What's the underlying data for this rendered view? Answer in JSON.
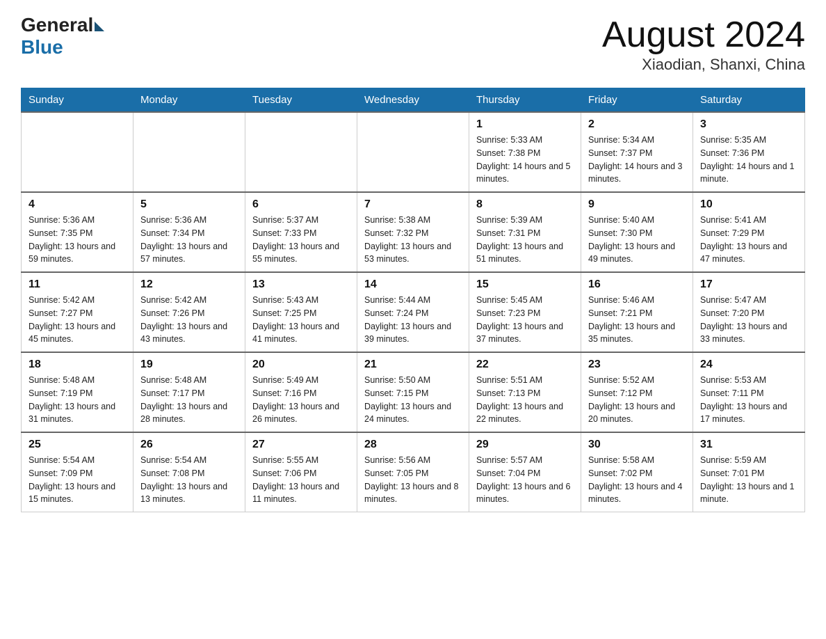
{
  "header": {
    "logo_general": "General",
    "logo_blue": "Blue",
    "title": "August 2024",
    "subtitle": "Xiaodian, Shanxi, China"
  },
  "days_of_week": [
    "Sunday",
    "Monday",
    "Tuesday",
    "Wednesday",
    "Thursday",
    "Friday",
    "Saturday"
  ],
  "weeks": [
    [
      {
        "day": "",
        "info": ""
      },
      {
        "day": "",
        "info": ""
      },
      {
        "day": "",
        "info": ""
      },
      {
        "day": "",
        "info": ""
      },
      {
        "day": "1",
        "info": "Sunrise: 5:33 AM\nSunset: 7:38 PM\nDaylight: 14 hours and 5 minutes."
      },
      {
        "day": "2",
        "info": "Sunrise: 5:34 AM\nSunset: 7:37 PM\nDaylight: 14 hours and 3 minutes."
      },
      {
        "day": "3",
        "info": "Sunrise: 5:35 AM\nSunset: 7:36 PM\nDaylight: 14 hours and 1 minute."
      }
    ],
    [
      {
        "day": "4",
        "info": "Sunrise: 5:36 AM\nSunset: 7:35 PM\nDaylight: 13 hours and 59 minutes."
      },
      {
        "day": "5",
        "info": "Sunrise: 5:36 AM\nSunset: 7:34 PM\nDaylight: 13 hours and 57 minutes."
      },
      {
        "day": "6",
        "info": "Sunrise: 5:37 AM\nSunset: 7:33 PM\nDaylight: 13 hours and 55 minutes."
      },
      {
        "day": "7",
        "info": "Sunrise: 5:38 AM\nSunset: 7:32 PM\nDaylight: 13 hours and 53 minutes."
      },
      {
        "day": "8",
        "info": "Sunrise: 5:39 AM\nSunset: 7:31 PM\nDaylight: 13 hours and 51 minutes."
      },
      {
        "day": "9",
        "info": "Sunrise: 5:40 AM\nSunset: 7:30 PM\nDaylight: 13 hours and 49 minutes."
      },
      {
        "day": "10",
        "info": "Sunrise: 5:41 AM\nSunset: 7:29 PM\nDaylight: 13 hours and 47 minutes."
      }
    ],
    [
      {
        "day": "11",
        "info": "Sunrise: 5:42 AM\nSunset: 7:27 PM\nDaylight: 13 hours and 45 minutes."
      },
      {
        "day": "12",
        "info": "Sunrise: 5:42 AM\nSunset: 7:26 PM\nDaylight: 13 hours and 43 minutes."
      },
      {
        "day": "13",
        "info": "Sunrise: 5:43 AM\nSunset: 7:25 PM\nDaylight: 13 hours and 41 minutes."
      },
      {
        "day": "14",
        "info": "Sunrise: 5:44 AM\nSunset: 7:24 PM\nDaylight: 13 hours and 39 minutes."
      },
      {
        "day": "15",
        "info": "Sunrise: 5:45 AM\nSunset: 7:23 PM\nDaylight: 13 hours and 37 minutes."
      },
      {
        "day": "16",
        "info": "Sunrise: 5:46 AM\nSunset: 7:21 PM\nDaylight: 13 hours and 35 minutes."
      },
      {
        "day": "17",
        "info": "Sunrise: 5:47 AM\nSunset: 7:20 PM\nDaylight: 13 hours and 33 minutes."
      }
    ],
    [
      {
        "day": "18",
        "info": "Sunrise: 5:48 AM\nSunset: 7:19 PM\nDaylight: 13 hours and 31 minutes."
      },
      {
        "day": "19",
        "info": "Sunrise: 5:48 AM\nSunset: 7:17 PM\nDaylight: 13 hours and 28 minutes."
      },
      {
        "day": "20",
        "info": "Sunrise: 5:49 AM\nSunset: 7:16 PM\nDaylight: 13 hours and 26 minutes."
      },
      {
        "day": "21",
        "info": "Sunrise: 5:50 AM\nSunset: 7:15 PM\nDaylight: 13 hours and 24 minutes."
      },
      {
        "day": "22",
        "info": "Sunrise: 5:51 AM\nSunset: 7:13 PM\nDaylight: 13 hours and 22 minutes."
      },
      {
        "day": "23",
        "info": "Sunrise: 5:52 AM\nSunset: 7:12 PM\nDaylight: 13 hours and 20 minutes."
      },
      {
        "day": "24",
        "info": "Sunrise: 5:53 AM\nSunset: 7:11 PM\nDaylight: 13 hours and 17 minutes."
      }
    ],
    [
      {
        "day": "25",
        "info": "Sunrise: 5:54 AM\nSunset: 7:09 PM\nDaylight: 13 hours and 15 minutes."
      },
      {
        "day": "26",
        "info": "Sunrise: 5:54 AM\nSunset: 7:08 PM\nDaylight: 13 hours and 13 minutes."
      },
      {
        "day": "27",
        "info": "Sunrise: 5:55 AM\nSunset: 7:06 PM\nDaylight: 13 hours and 11 minutes."
      },
      {
        "day": "28",
        "info": "Sunrise: 5:56 AM\nSunset: 7:05 PM\nDaylight: 13 hours and 8 minutes."
      },
      {
        "day": "29",
        "info": "Sunrise: 5:57 AM\nSunset: 7:04 PM\nDaylight: 13 hours and 6 minutes."
      },
      {
        "day": "30",
        "info": "Sunrise: 5:58 AM\nSunset: 7:02 PM\nDaylight: 13 hours and 4 minutes."
      },
      {
        "day": "31",
        "info": "Sunrise: 5:59 AM\nSunset: 7:01 PM\nDaylight: 13 hours and 1 minute."
      }
    ]
  ]
}
